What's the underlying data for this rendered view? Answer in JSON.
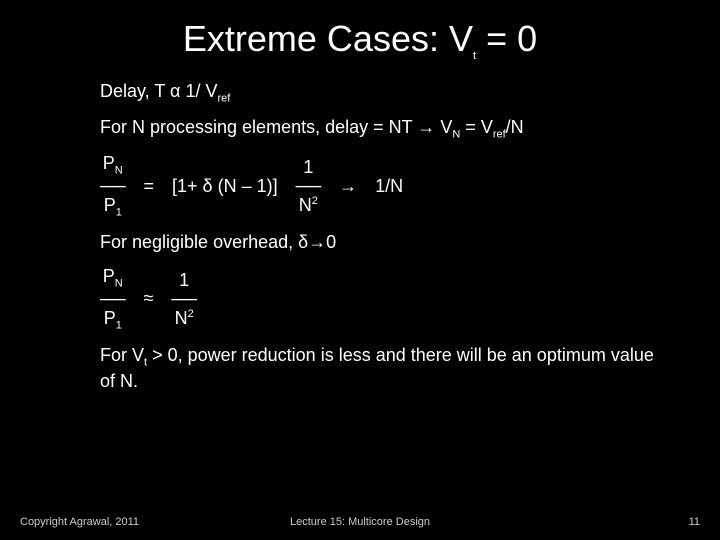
{
  "title": {
    "main": "Extreme Cases: V",
    "sub": "t",
    "rest": " = 0"
  },
  "body": {
    "delay_prefix": "Delay, T α  1/ V",
    "delay_sub": "ref",
    "processing_prefix": "For N processing elements, delay = NT  → ",
    "processing_vn_v": "V",
    "processing_vn_n": "N",
    "processing_eq": " = ",
    "processing_vref_v": "V",
    "processing_vref_ref": "ref",
    "processing_over_n": "/N",
    "negligible": "For negligible overhead, δ→0",
    "conclusion_prefix": "For V",
    "conclusion_sub": "t",
    "conclusion_rest": " > 0, power reduction is less and there will be an optimum value of N."
  },
  "eq1": {
    "frac1": {
      "top_p": "P",
      "top_n": "N",
      "bot_p": "P",
      "bot_1": "1"
    },
    "eq": "=",
    "bracket": "[1+ δ (N – 1)]",
    "frac2": {
      "top": "1",
      "bot_n": "N",
      "bot_2": "2"
    },
    "arrow": "→",
    "result": "1/N",
    "bar": "──"
  },
  "eq2": {
    "frac1": {
      "top_p": "P",
      "top_n": "N",
      "bot_p": "P",
      "bot_1": "1"
    },
    "approx": "≈",
    "frac2": {
      "top": "1",
      "bot_n": "N",
      "bot_2": "2"
    },
    "bar": "──"
  },
  "footer": {
    "left": "Copyright Agrawal, 2011",
    "center": "Lecture 15: Multicore Design",
    "right": "11"
  }
}
